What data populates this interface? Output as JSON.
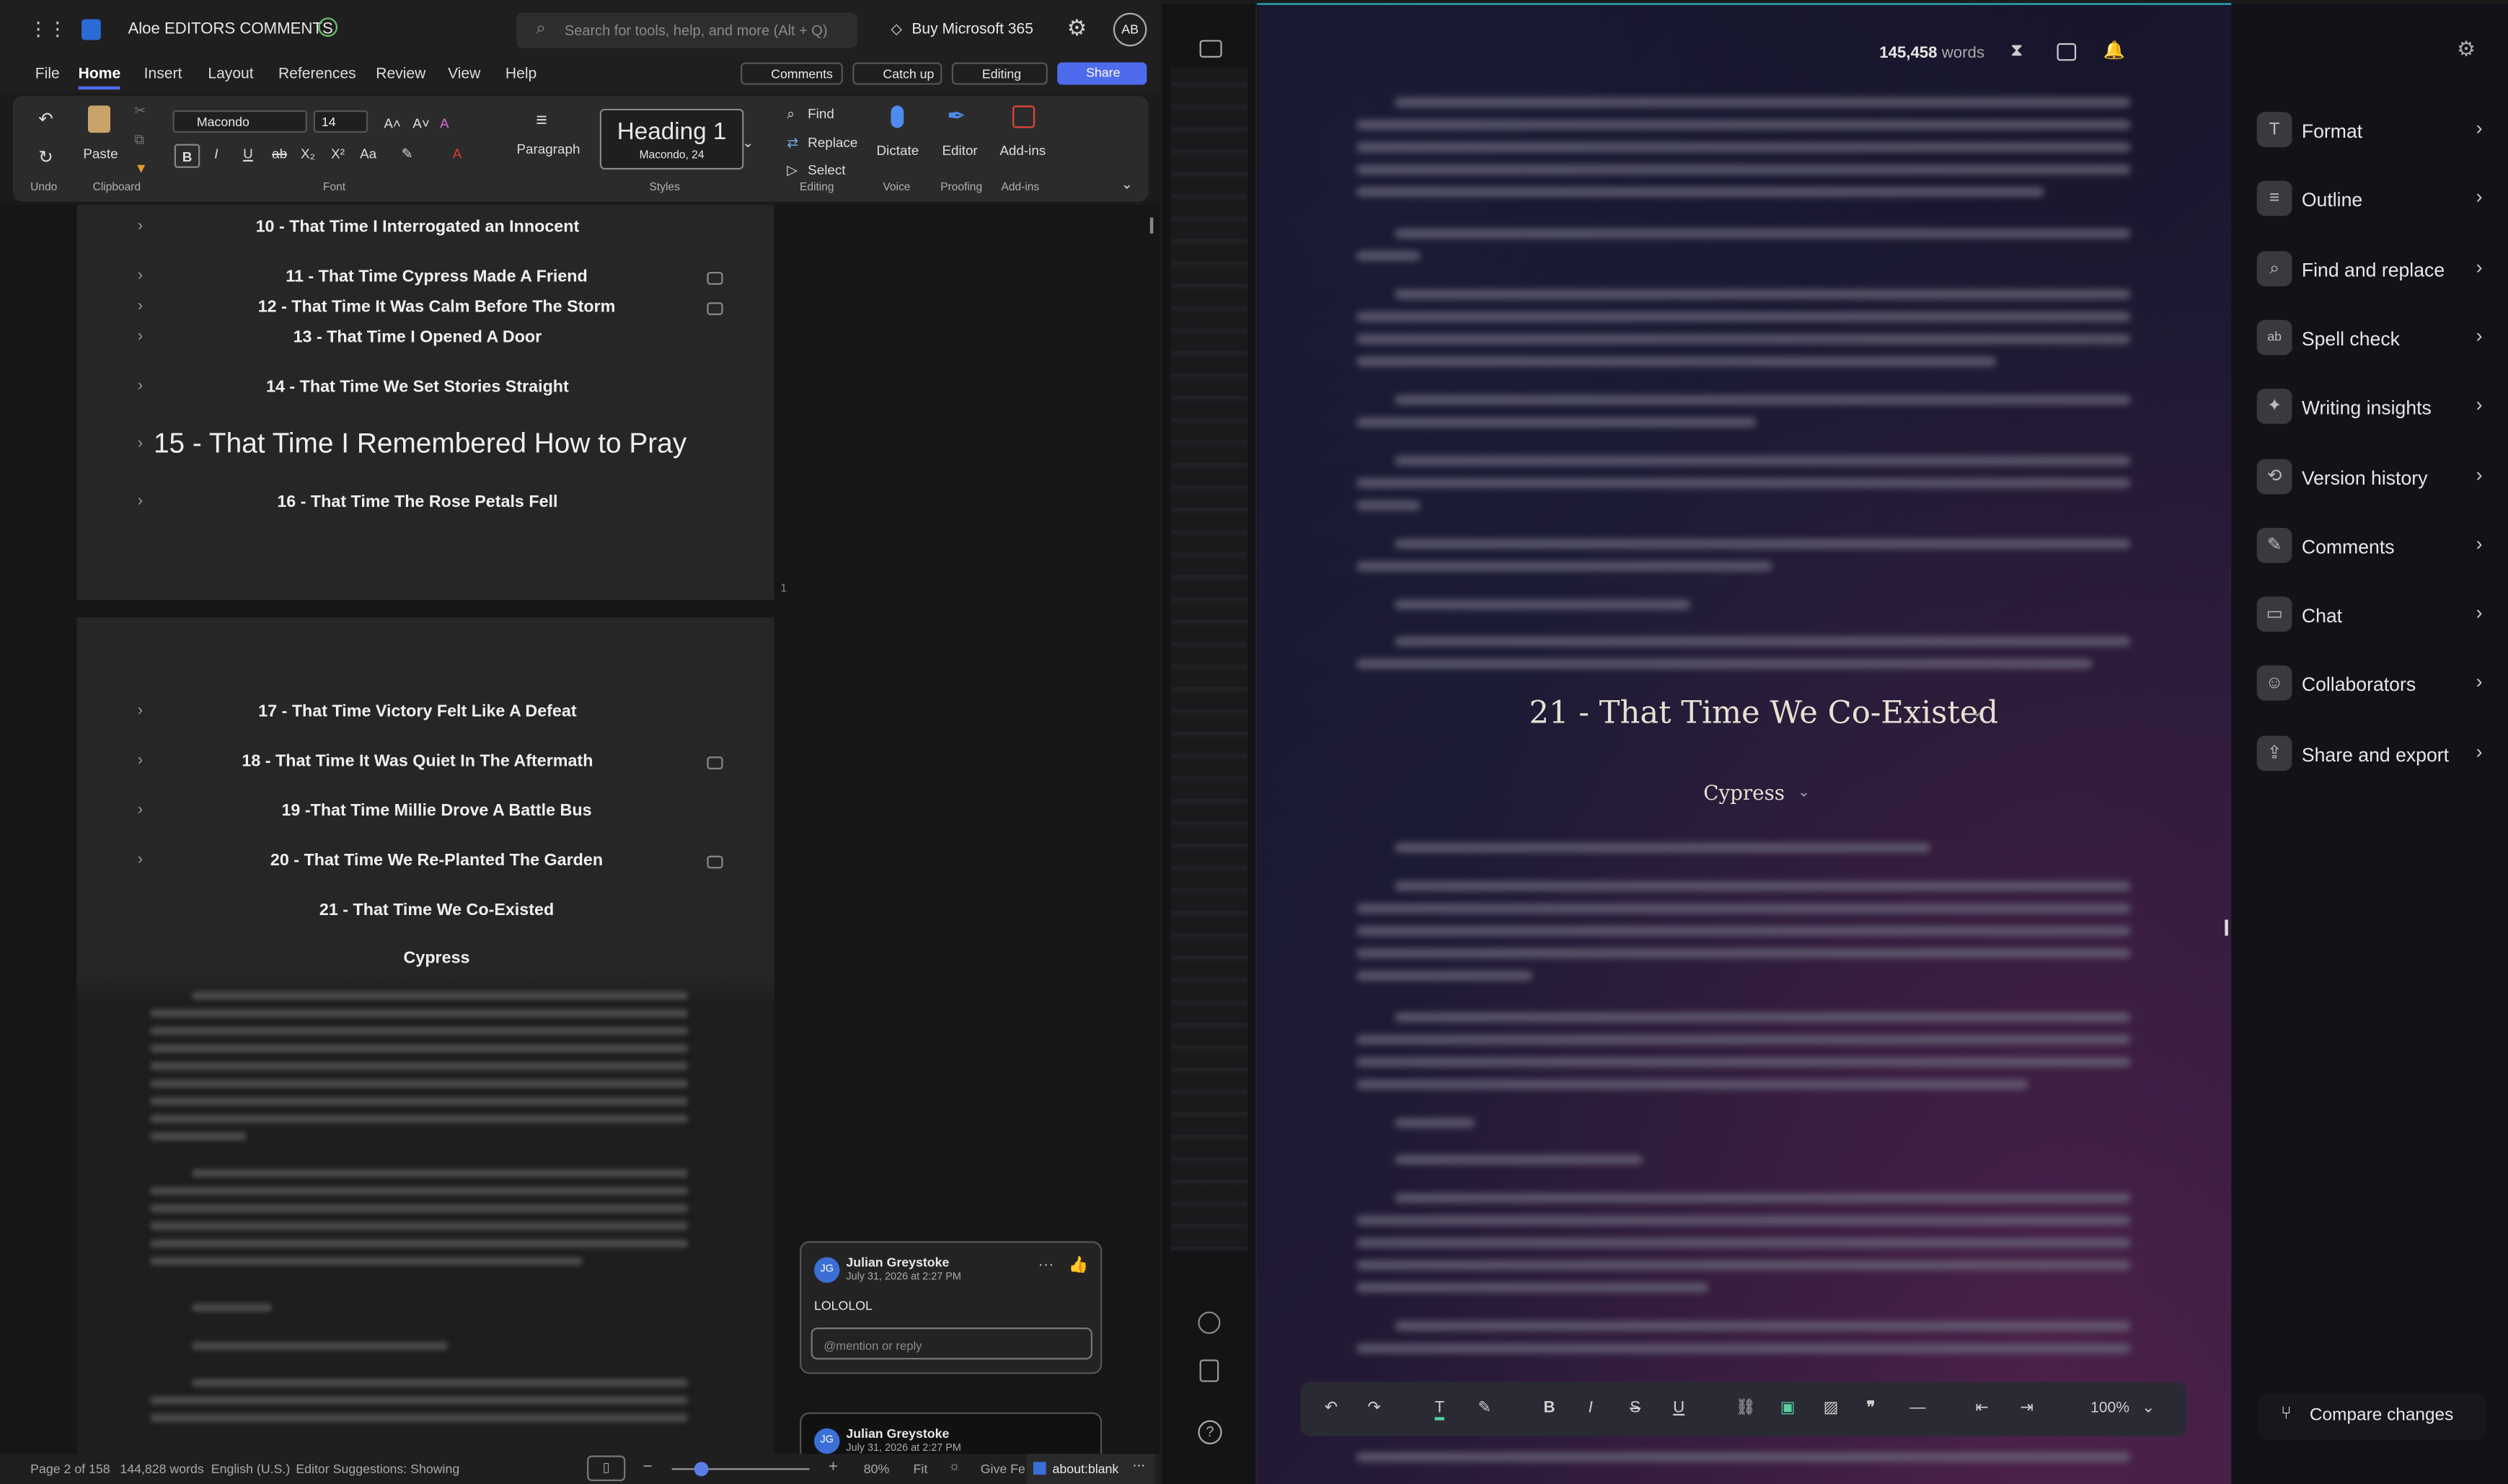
{
  "word": {
    "doc_title": "Aloe EDITORS COMMENTS",
    "search_placeholder": "Search for tools, help, and more (Alt + Q)",
    "buy": "Buy Microsoft 365",
    "avatar": "AB",
    "menu": [
      "File",
      "Home",
      "Insert",
      "Layout",
      "References",
      "Review",
      "View",
      "Help"
    ],
    "comments_btn": "Comments",
    "catchup_btn": "Catch up",
    "editing_btn": "Editing",
    "share_btn": "Share",
    "ribbon": {
      "undo_label": "Undo",
      "paste": "Paste",
      "clipboard": "Clipboard",
      "font_name": "Macondo",
      "font_size": "14",
      "font_group": "Font",
      "paragraph": "Paragraph",
      "style_name": "Heading 1",
      "style_sub": "Macondo, 24",
      "styles_group": "Styles",
      "find": "Find",
      "replace": "Replace",
      "select": "Select",
      "editing_group": "Editing",
      "dictate": "Dictate",
      "voice_group": "Voice",
      "editor": "Editor",
      "proofing_group": "Proofing",
      "addins": "Add-ins",
      "addins_group": "Add-ins"
    },
    "headings": [
      "10 - That Time I Interrogated an Innocent",
      "11 - That Time Cypress Made A Friend",
      "12 - That Time It Was Calm Before The Storm",
      "13 - That Time I Opened A Door",
      "14 - That Time We Set Stories Straight",
      "15 - That Time I Remembered How to Pray",
      "16 - That Time The Rose Petals Fell",
      "17 - That Time Victory Felt Like A Defeat",
      "18 - That Time It Was Quiet In The Aftermath",
      "19 -That Time Millie Drove A Battle Bus",
      "20 - That Time We Re-Planted The Garden",
      "21 - That Time We Co-Existed"
    ],
    "subheading": "Cypress",
    "page_num_marker": "1",
    "comment": {
      "initials": "JG",
      "author": "Julian Greystoke",
      "date": "July 31, 2026 at 2:27 PM",
      "text": "LOLOLOL",
      "reply_placeholder": "@mention or reply"
    },
    "comment2": {
      "initials": "JG",
      "author": "Julian Greystoke",
      "date": "July 31, 2026 at 2:27 PM"
    },
    "status": {
      "page": "Page 2 of 158",
      "words": "144,828 words",
      "lang": "English (U.S.)",
      "editor": "Editor Suggestions: Showing",
      "zoom": "80%",
      "fit": "Fit",
      "feedback": "Give Fe",
      "tab": "about:blank"
    }
  },
  "editor": {
    "word_count": "145,458",
    "words_label": "words",
    "chapter_title": "21 - That Time We Co-Existed",
    "subtitle": "Cypress",
    "zoom": "100%",
    "compare": "Compare changes",
    "sidebar": [
      {
        "label": "Format",
        "icon": "T"
      },
      {
        "label": "Outline",
        "icon": "≡"
      },
      {
        "label": "Find and replace",
        "icon": "⌕"
      },
      {
        "label": "Spell check",
        "icon": "ab"
      },
      {
        "label": "Writing insights",
        "icon": "✦"
      },
      {
        "label": "Version history",
        "icon": "⟲"
      },
      {
        "label": "Comments",
        "icon": "✎"
      },
      {
        "label": "Chat",
        "icon": "▭"
      },
      {
        "label": "Collaborators",
        "icon": "☺"
      },
      {
        "label": "Share and export",
        "icon": "⇪"
      }
    ]
  },
  "colors": {
    "accent": "#2fb4c6",
    "word_blue": "#4f6bed"
  }
}
